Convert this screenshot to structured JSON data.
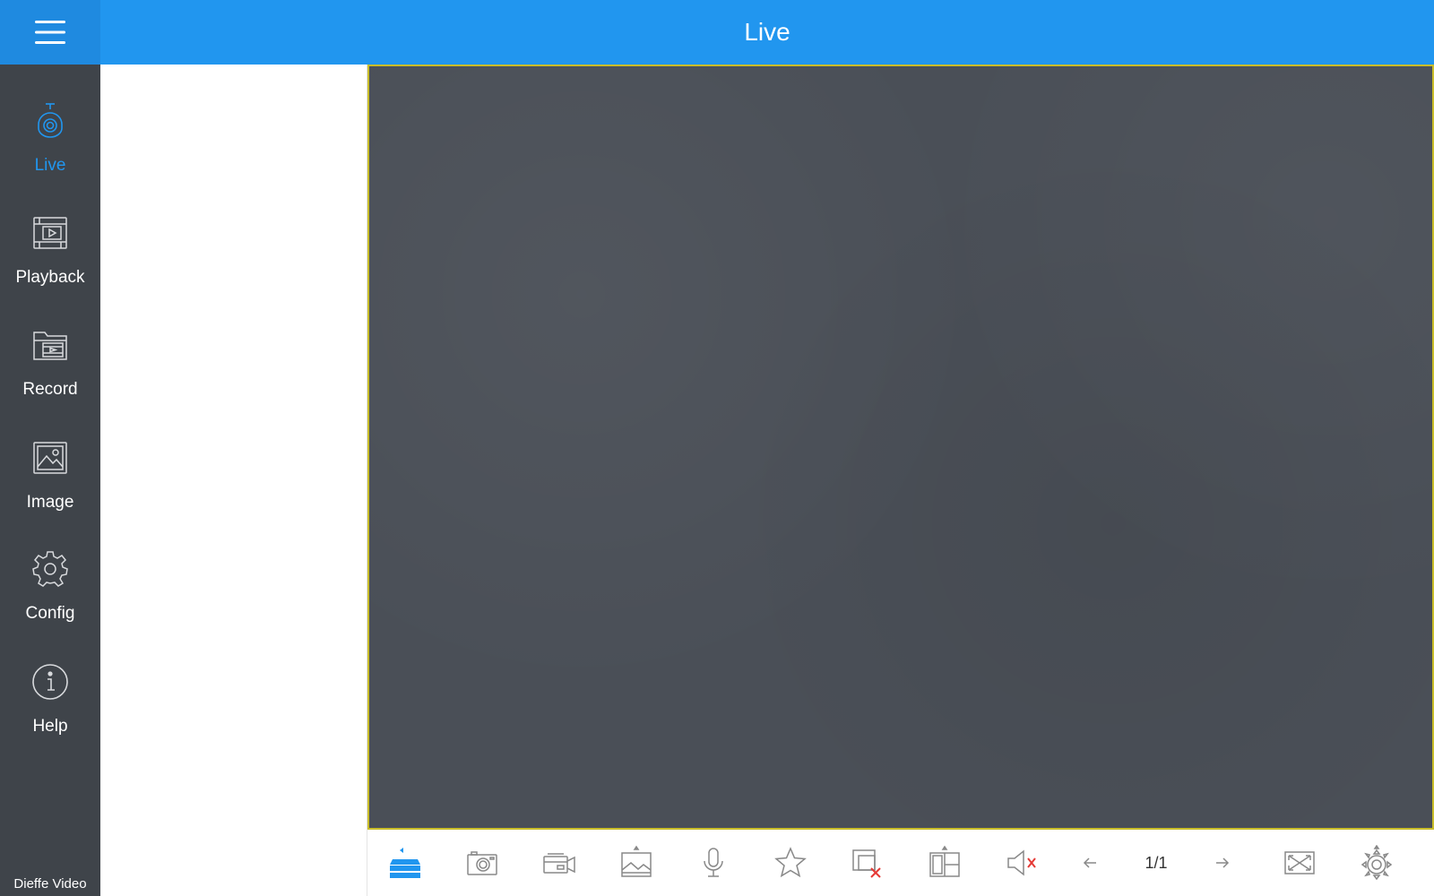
{
  "header": {
    "title": "Live"
  },
  "sidebar": {
    "items": [
      {
        "id": "live",
        "label": "Live",
        "icon": "camera-icon",
        "active": true
      },
      {
        "id": "playback",
        "label": "Playback",
        "icon": "playback-icon",
        "active": false
      },
      {
        "id": "record",
        "label": "Record",
        "icon": "record-folder-icon",
        "active": false
      },
      {
        "id": "image",
        "label": "Image",
        "icon": "image-icon",
        "active": false
      },
      {
        "id": "config",
        "label": "Config",
        "icon": "gear-icon",
        "active": false
      },
      {
        "id": "help",
        "label": "Help",
        "icon": "info-icon",
        "active": false
      }
    ],
    "brand": "Dieffe Video"
  },
  "toolbar": {
    "page_indicator": "1/1",
    "buttons": [
      "device-list-icon",
      "snapshot-icon",
      "record-video-icon",
      "image-quality-icon",
      "microphone-icon",
      "favorite-star-icon",
      "close-window-icon",
      "split-layout-icon",
      "mute-icon",
      "previous-page-icon",
      "next-page-icon",
      "fullscreen-icon",
      "ptz-icon"
    ]
  },
  "colors": {
    "header": "#2196ef",
    "sidebar": "#3f444a",
    "accent": "#2196ef",
    "video_background": "#4a4f57",
    "selected_window_border": "#c9bd2a",
    "close_red": "#e53935"
  }
}
